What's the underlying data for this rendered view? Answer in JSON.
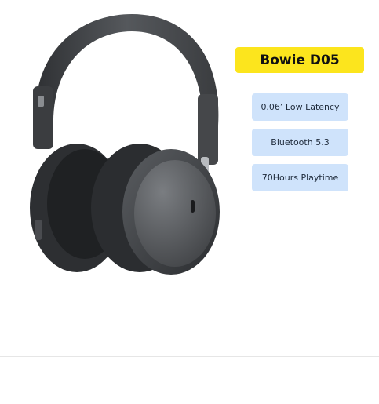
{
  "product": {
    "title": "Bowie D05",
    "image_subject": "headphones-image"
  },
  "features": [
    {
      "label": "0.06’ Low Latency"
    },
    {
      "label": "Bluetooth 5.3"
    },
    {
      "label": "70Hours Playtime"
    }
  ],
  "colors": {
    "title_badge": "#fce51d",
    "feature_badge": "#cfe3fb",
    "headphone_body": "#3d3f42"
  }
}
